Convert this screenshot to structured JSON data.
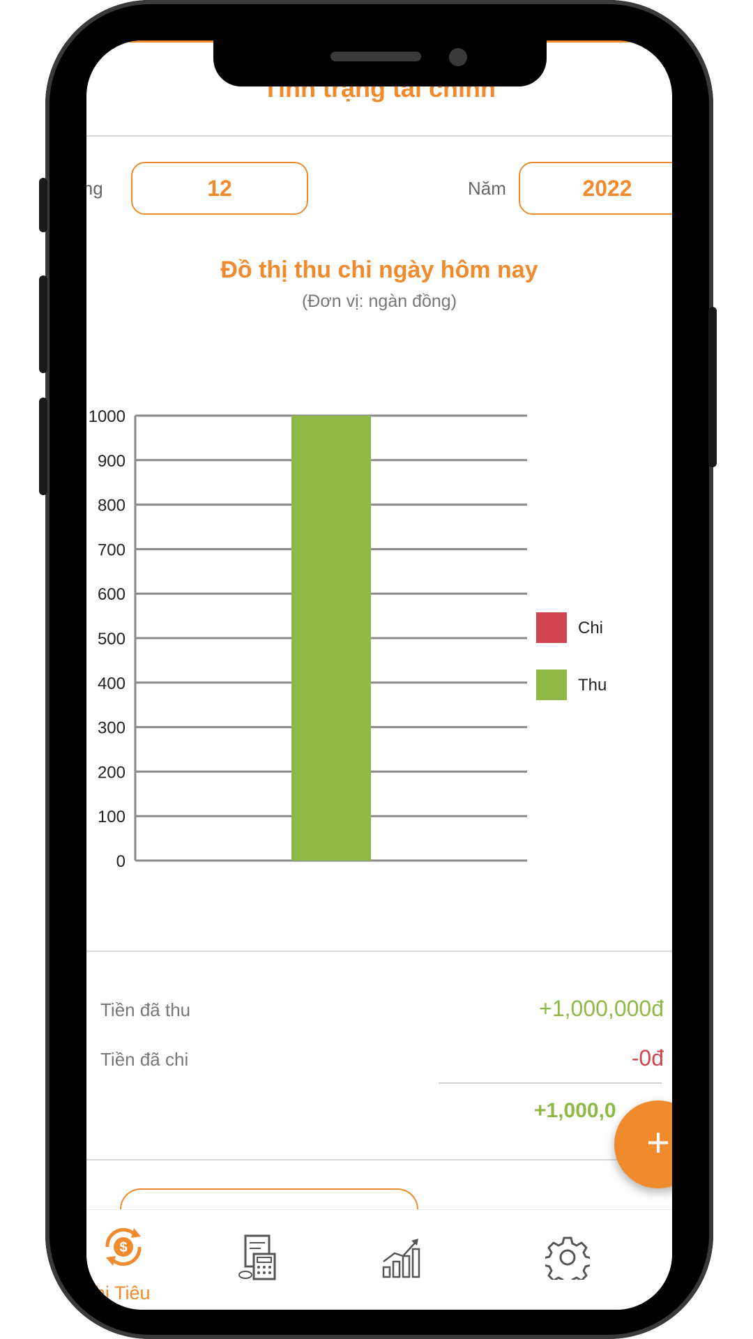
{
  "header": {
    "title": "Tình trạng tài chính"
  },
  "filters": {
    "month_label": "Tháng",
    "month_value": "12",
    "year_label": "Năm",
    "year_value": "2022"
  },
  "chart": {
    "title": "Đồ thị thu chi ngày hôm nay",
    "subtitle": "(Đơn vị: ngàn đồng)"
  },
  "chart_data": {
    "type": "bar",
    "categories": [
      ""
    ],
    "series": [
      {
        "name": "Chi",
        "values": [
          0
        ],
        "color": "#d0454f"
      },
      {
        "name": "Thu",
        "values": [
          1000
        ],
        "color": "#8fb946"
      }
    ],
    "yticks": [
      0,
      100,
      200,
      300,
      400,
      500,
      600,
      700,
      800,
      900,
      1000
    ],
    "ylim": [
      0,
      1000
    ],
    "grid": true,
    "legend": "right"
  },
  "summary": {
    "income_label": "Tiền đã thu",
    "income_value": "+1,000,000đ",
    "expense_label": "Tiền đã chi",
    "expense_value": "-0đ",
    "total_value": "+1,000,0"
  },
  "fab": {
    "label": "+"
  },
  "nav": {
    "items": [
      {
        "label": "hi Tiêu",
        "icon": "money-cycle-icon",
        "active": true
      },
      {
        "label": "",
        "icon": "calculator-document-icon",
        "active": false
      },
      {
        "label": "",
        "icon": "growth-chart-icon",
        "active": false
      },
      {
        "label": "",
        "icon": "gear-icon",
        "active": false
      }
    ]
  },
  "colors": {
    "accent": "#f08a2c",
    "income": "#8fb946",
    "expense": "#d0454f"
  }
}
